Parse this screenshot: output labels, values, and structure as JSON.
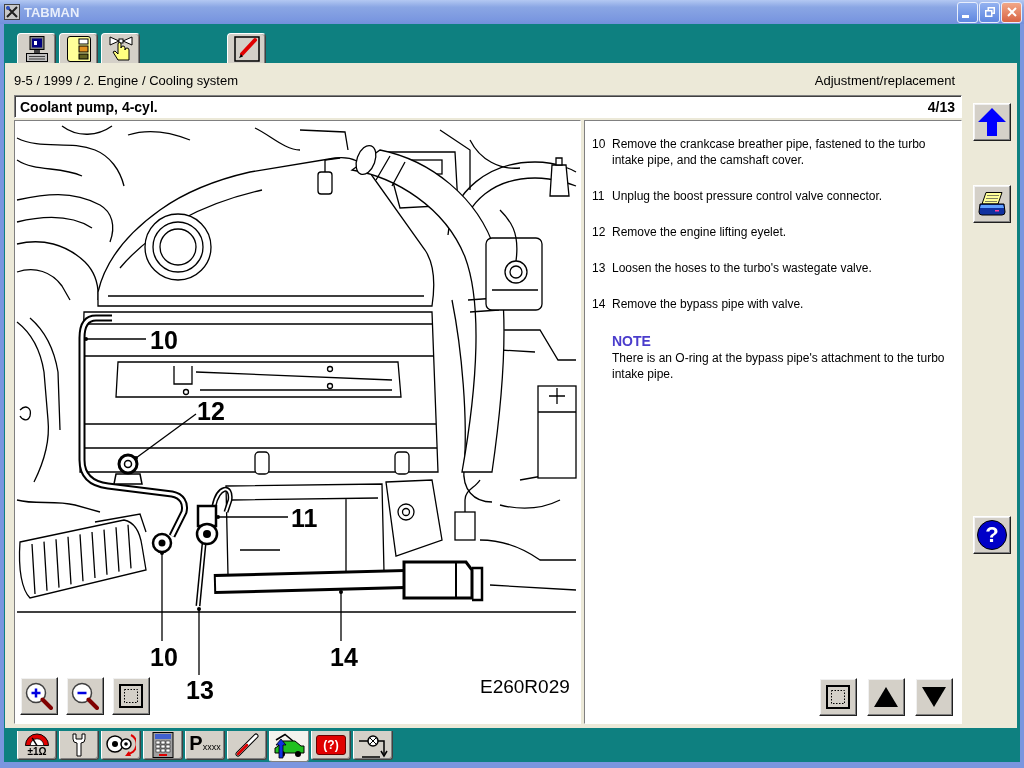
{
  "window": {
    "title": "TABMAN"
  },
  "tabs": [
    {
      "kind": "computer",
      "selected": false
    },
    {
      "kind": "binder",
      "selected": false
    },
    {
      "kind": "hand",
      "selected": false
    },
    {
      "kind": "pencil",
      "selected": false
    }
  ],
  "document": {
    "breadcrumb": "9-5 / 1999 / 2. Engine / Cooling system",
    "section": "Adjustment/replacement",
    "title": "Coolant pump, 4-cyl.",
    "page": "4/13"
  },
  "figure": {
    "callouts": [
      "10",
      "12",
      "11",
      "10",
      "13",
      "14"
    ],
    "code": "E260R029"
  },
  "steps": [
    {
      "number": "10",
      "text": "Remove the crankcase breather pipe, fastened to the turbo intake pipe, and the camshaft cover."
    },
    {
      "number": "11",
      "text": "Unplug the boost pressure control valve connector."
    },
    {
      "number": "12",
      "text": "Remove the engine lifting eyelet."
    },
    {
      "number": "13",
      "text": "Loosen the hoses to the turbo's wastegate valve."
    },
    {
      "number": "14",
      "text": "Remove the bypass pipe with valve."
    }
  ],
  "note": {
    "heading": "NOTE",
    "text": "There is an O-ring at the bypass pipe's attachment to the turbo intake pipe."
  },
  "sidebar": {
    "help_label": "?"
  },
  "toolbar": [
    {
      "kind": "meter",
      "label": "±1Ω",
      "selected": false
    },
    {
      "kind": "wrench",
      "selected": false
    },
    {
      "kind": "discs",
      "selected": false
    },
    {
      "kind": "keypad",
      "selected": false
    },
    {
      "kind": "code",
      "label": "P$_{xxxx}$",
      "selected": false
    },
    {
      "kind": "thermometer",
      "selected": false
    },
    {
      "kind": "car",
      "selected": true
    },
    {
      "kind": "alert",
      "label": "(?)",
      "selected": false
    },
    {
      "kind": "lamp",
      "selected": false
    }
  ]
}
